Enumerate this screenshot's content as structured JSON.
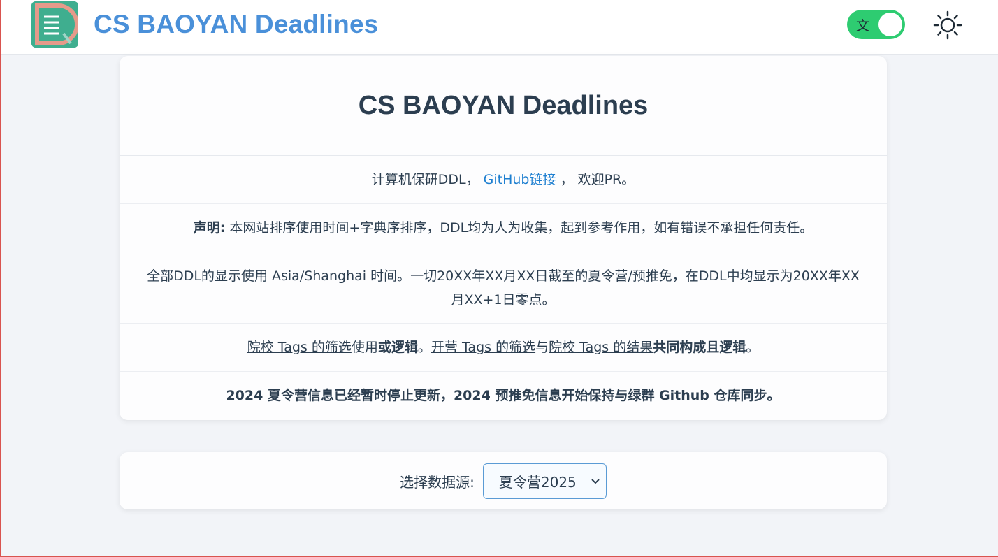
{
  "header": {
    "brand": "CS BAOYAN Deadlines",
    "lang_toggle_label": "文",
    "theme_icon": "sun-icon"
  },
  "intro": {
    "title": "CS BAOYAN Deadlines",
    "line1_prefix": "计算机保研DDL，",
    "line1_link": "GitHub链接",
    "line1_suffix": "， 欢迎PR。",
    "disclaimer_label": "声明:",
    "disclaimer_text": " 本网站排序使用时间+字典序排序，DDL均为人为收集，起到参考作用，如有错误不承担任何责任。",
    "timezone_text": "全部DDL的显示使用 Asia/Shanghai 时间。一切20XX年XX月XX日截至的夏令营/预推免，在DDL中均显示为20XX年XX月XX+1日零点。",
    "tags_part1": "院校 Tags 的筛选",
    "tags_part2": "使用",
    "tags_part3": "或逻辑",
    "tags_part4": "。",
    "tags_part5": "开营 Tags 的筛选",
    "tags_part6": "与",
    "tags_part7": "院校 Tags 的结果",
    "tags_part8": "共同构成且逻辑",
    "tags_part9": "。",
    "notice": "2024 夏令营信息已经暂时停止更新，2024 预推免信息开始保持与绿群 Github 仓库同步。"
  },
  "data_source": {
    "label": "选择数据源:",
    "selected": "夏令营2025"
  },
  "colors": {
    "brand": "#4a90d9",
    "toggle_on": "#2ecc71",
    "link": "#1e7fd0"
  }
}
